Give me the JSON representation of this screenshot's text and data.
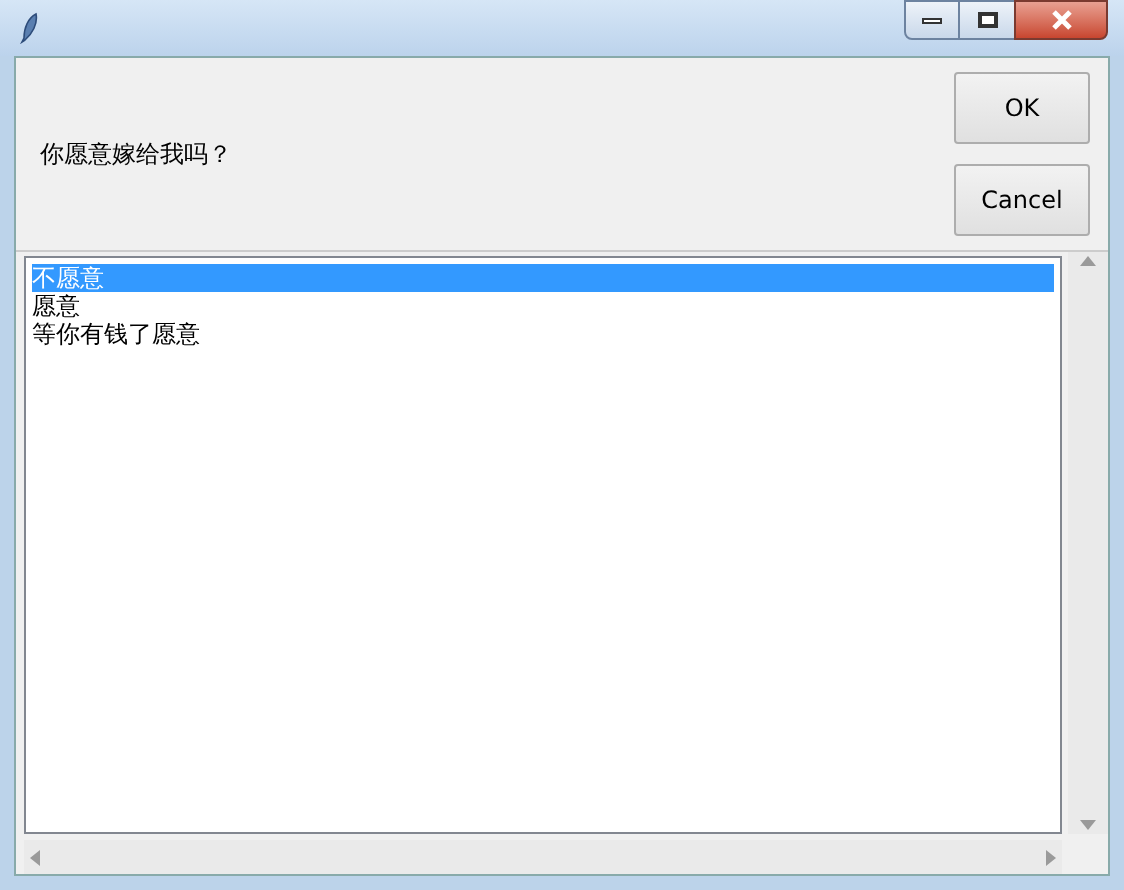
{
  "prompt": "你愿意嫁给我吗？",
  "buttons": [
    {
      "label": "OK"
    },
    {
      "label": "Cancel"
    }
  ],
  "listbox": {
    "items": [
      {
        "label": "不愿意",
        "selected": true
      },
      {
        "label": "愿意",
        "selected": false
      },
      {
        "label": "等你有钱了愿意",
        "selected": false
      }
    ]
  }
}
